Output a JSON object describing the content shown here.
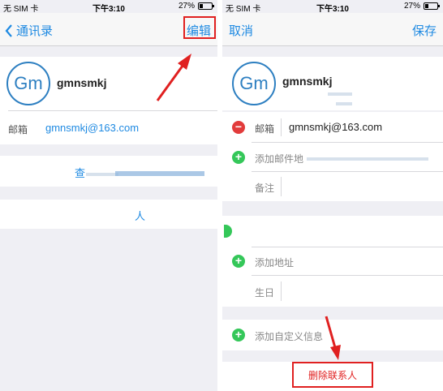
{
  "status": {
    "carrier": "无 SIM 卡",
    "time": "下午3:10",
    "battery": "27%",
    "battery_fraction": 0.27
  },
  "left": {
    "nav_back": "通讯录",
    "nav_edit": "编辑",
    "avatar_initials": "Gm",
    "name": "gmnsmkj",
    "email_label": "邮箱",
    "email_value": "gmnsmkj@163.com",
    "action1": "查",
    "action2": "人"
  },
  "right": {
    "nav_cancel": "取消",
    "nav_save": "保存",
    "avatar_initials": "Gm",
    "name": "gmnsmkj",
    "email_label": "邮箱",
    "email_value": "gmnsmkj@163.com",
    "add_email": "添加邮件地",
    "notes_label": "备注",
    "add_address": "添加地址",
    "birthday_label": "生日",
    "add_custom": "添加自定义信息",
    "delete_contact": "删除联系人"
  },
  "colors": {
    "accent": "#1f8ae2",
    "annotation_red": "#e02020",
    "delete_minus": "#e23b3b",
    "add_plus": "#34c759"
  }
}
